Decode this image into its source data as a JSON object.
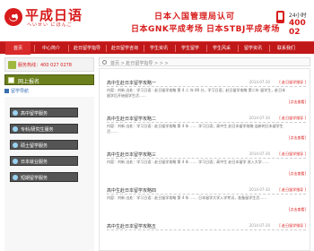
{
  "header": {
    "logo_title": "平成日语",
    "logo_sub": "へいせい にほんご",
    "slogan1": "日本入国管理局认可",
    "slogan2": "日本GNK平成考场  日本STBJ平成考场",
    "hotline_label": "24小时",
    "hotline_num": "400 02"
  },
  "nav": [
    "首页",
    "中心简介",
    "赴日留学指导",
    "赴日留学咨询",
    "学生资讯",
    "学生留学",
    "学生风采",
    "留学资讯",
    "联系我们"
  ],
  "sidebar": {
    "hotline": "服务热线：400 027 0278",
    "signup": "网上报名",
    "section": "留学导航",
    "items": [
      "高中留学服务",
      "专科/研究生服务",
      "硕士留学服务",
      "日本就业服务",
      "短期留学服务"
    ]
  },
  "main": {
    "breadcrumb": "首页 > 赴日留学指导 > > >",
    "articles": [
      {
        "title": "高中生赴日本留学攻略一",
        "date": "2014-07-30",
        "more": "[ 赴日留学指导 ]",
        "body": "内容：刘新 出处：学习日语：赴日留学攻略 第 4 二 年 80 分，学习日语；赴日留学攻略 第二年 留学生，赴日本留学后开始留学生活……",
        "detail": "[点击查看]"
      },
      {
        "title": "高中生赴日本留学攻略二",
        "date": "2014-07-30",
        "more": "[ 赴日留学指导 ]",
        "body": "内容：刘新 出处：学习日语：赴日留学攻略 第 4 年 …… 学习日语；高中生 赴日本留学攻略 连新的日本留学生活……",
        "detail": "[点击查看]"
      },
      {
        "title": "高中生赴日本留学攻略三",
        "date": "2014-07-30",
        "more": "[ 赴日留学指导 ]",
        "body": "内容：刘新 出处：学习日语：赴日留学攻略 第 4 年 …… 学习日语；高中生 赴日本留学 进入大学……",
        "detail": "[点击查看]"
      },
      {
        "title": "高中生赴日本留学攻略四",
        "date": "2014-07-30",
        "more": "[ 赴日留学指导 ]",
        "body": "内容：刘新 出处：学习日语：赴日留学攻略 第 4 年 …… 日本留学大学入学考试，准备留学生活……",
        "detail": "[点击查看]"
      },
      {
        "title": "高中生赴日本留学攻略五",
        "date": "2014-07-30",
        "more": "[ 赴日留学指导 ]",
        "body": "",
        "detail": ""
      }
    ]
  },
  "colors": {
    "brand": "#d81b1b",
    "nav": "#c01818",
    "signup": "#6b7f1d"
  }
}
